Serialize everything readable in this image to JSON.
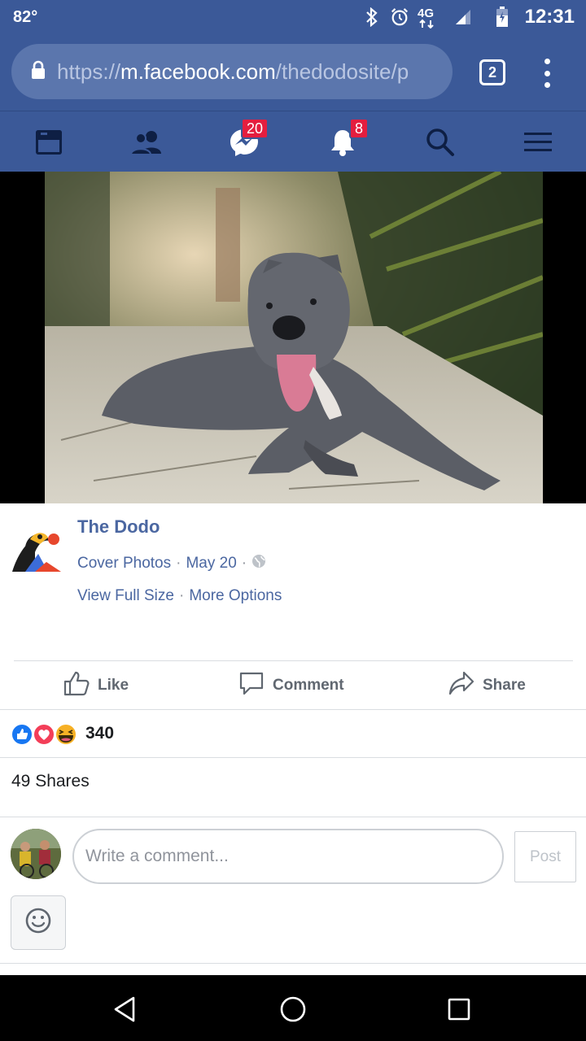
{
  "status_bar": {
    "temperature": "82°",
    "network": "4G",
    "time": "12:31",
    "icons": [
      "bluetooth-icon",
      "alarm-icon",
      "4g-lte-icon",
      "signal-icon",
      "battery-icon"
    ]
  },
  "browser": {
    "url_prefix": "https://",
    "url_domain": "m.facebook.com",
    "url_path": "/thedodosite/p",
    "tab_count": "2"
  },
  "fb_nav": {
    "items": [
      {
        "name": "news-feed",
        "icon": "news-feed-icon"
      },
      {
        "name": "friends",
        "icon": "friends-icon"
      },
      {
        "name": "messenger",
        "icon": "messenger-icon",
        "badge": "20"
      },
      {
        "name": "notifications",
        "icon": "bell-icon",
        "badge": "8"
      },
      {
        "name": "search",
        "icon": "search-icon"
      },
      {
        "name": "menu",
        "icon": "hamburger-icon"
      }
    ]
  },
  "post": {
    "page_name": "The Dodo",
    "album": "Cover Photos",
    "date": "May 20",
    "sep": "·",
    "view_full_size": "View Full Size",
    "more_options": "More Options"
  },
  "actions": {
    "like": "Like",
    "comment": "Comment",
    "share": "Share"
  },
  "reactions": {
    "count": "340",
    "types": [
      "like",
      "love",
      "haha"
    ]
  },
  "shares": {
    "text": "49 Shares"
  },
  "composer": {
    "placeholder": "Write a comment...",
    "post_label": "Post"
  },
  "colors": {
    "fb_blue": "#3b5998",
    "link_blue": "#4b67a1",
    "badge_red": "#e41e3f"
  }
}
